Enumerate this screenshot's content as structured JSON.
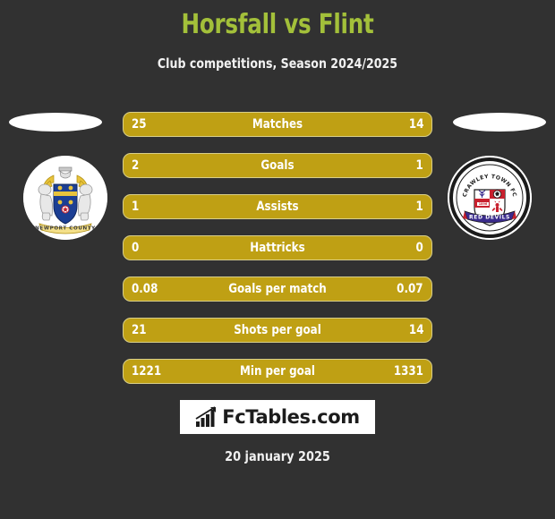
{
  "header": {
    "title": "Horsfall vs Flint",
    "subtitle": "Club competitions, Season 2024/2025",
    "title_color": "#a3c03a",
    "subtitle_color": "#ffffff"
  },
  "background_color": "#313131",
  "bar_color": "#bfa014",
  "crests": {
    "home": {
      "name": "newport-county-crest",
      "caption": "NEWPORT COUNTY"
    },
    "away": {
      "name": "crawley-town-crest",
      "caption_top": "CRAWLEY TOWN FC",
      "caption_bottom": "RED DEVILS"
    }
  },
  "stats": [
    {
      "label": "Matches",
      "home": "25",
      "away": "14"
    },
    {
      "label": "Goals",
      "home": "2",
      "away": "1"
    },
    {
      "label": "Assists",
      "home": "1",
      "away": "1"
    },
    {
      "label": "Hattricks",
      "home": "0",
      "away": "0"
    },
    {
      "label": "Goals per match",
      "home": "0.08",
      "away": "0.07"
    },
    {
      "label": "Shots per goal",
      "home": "21",
      "away": "14"
    },
    {
      "label": "Min per goal",
      "home": "1221",
      "away": "1331"
    }
  ],
  "footer": {
    "logo_text": "FcTables.com",
    "logo_icon": "bar-chart-arrow-icon",
    "date": "20 january 2025"
  }
}
